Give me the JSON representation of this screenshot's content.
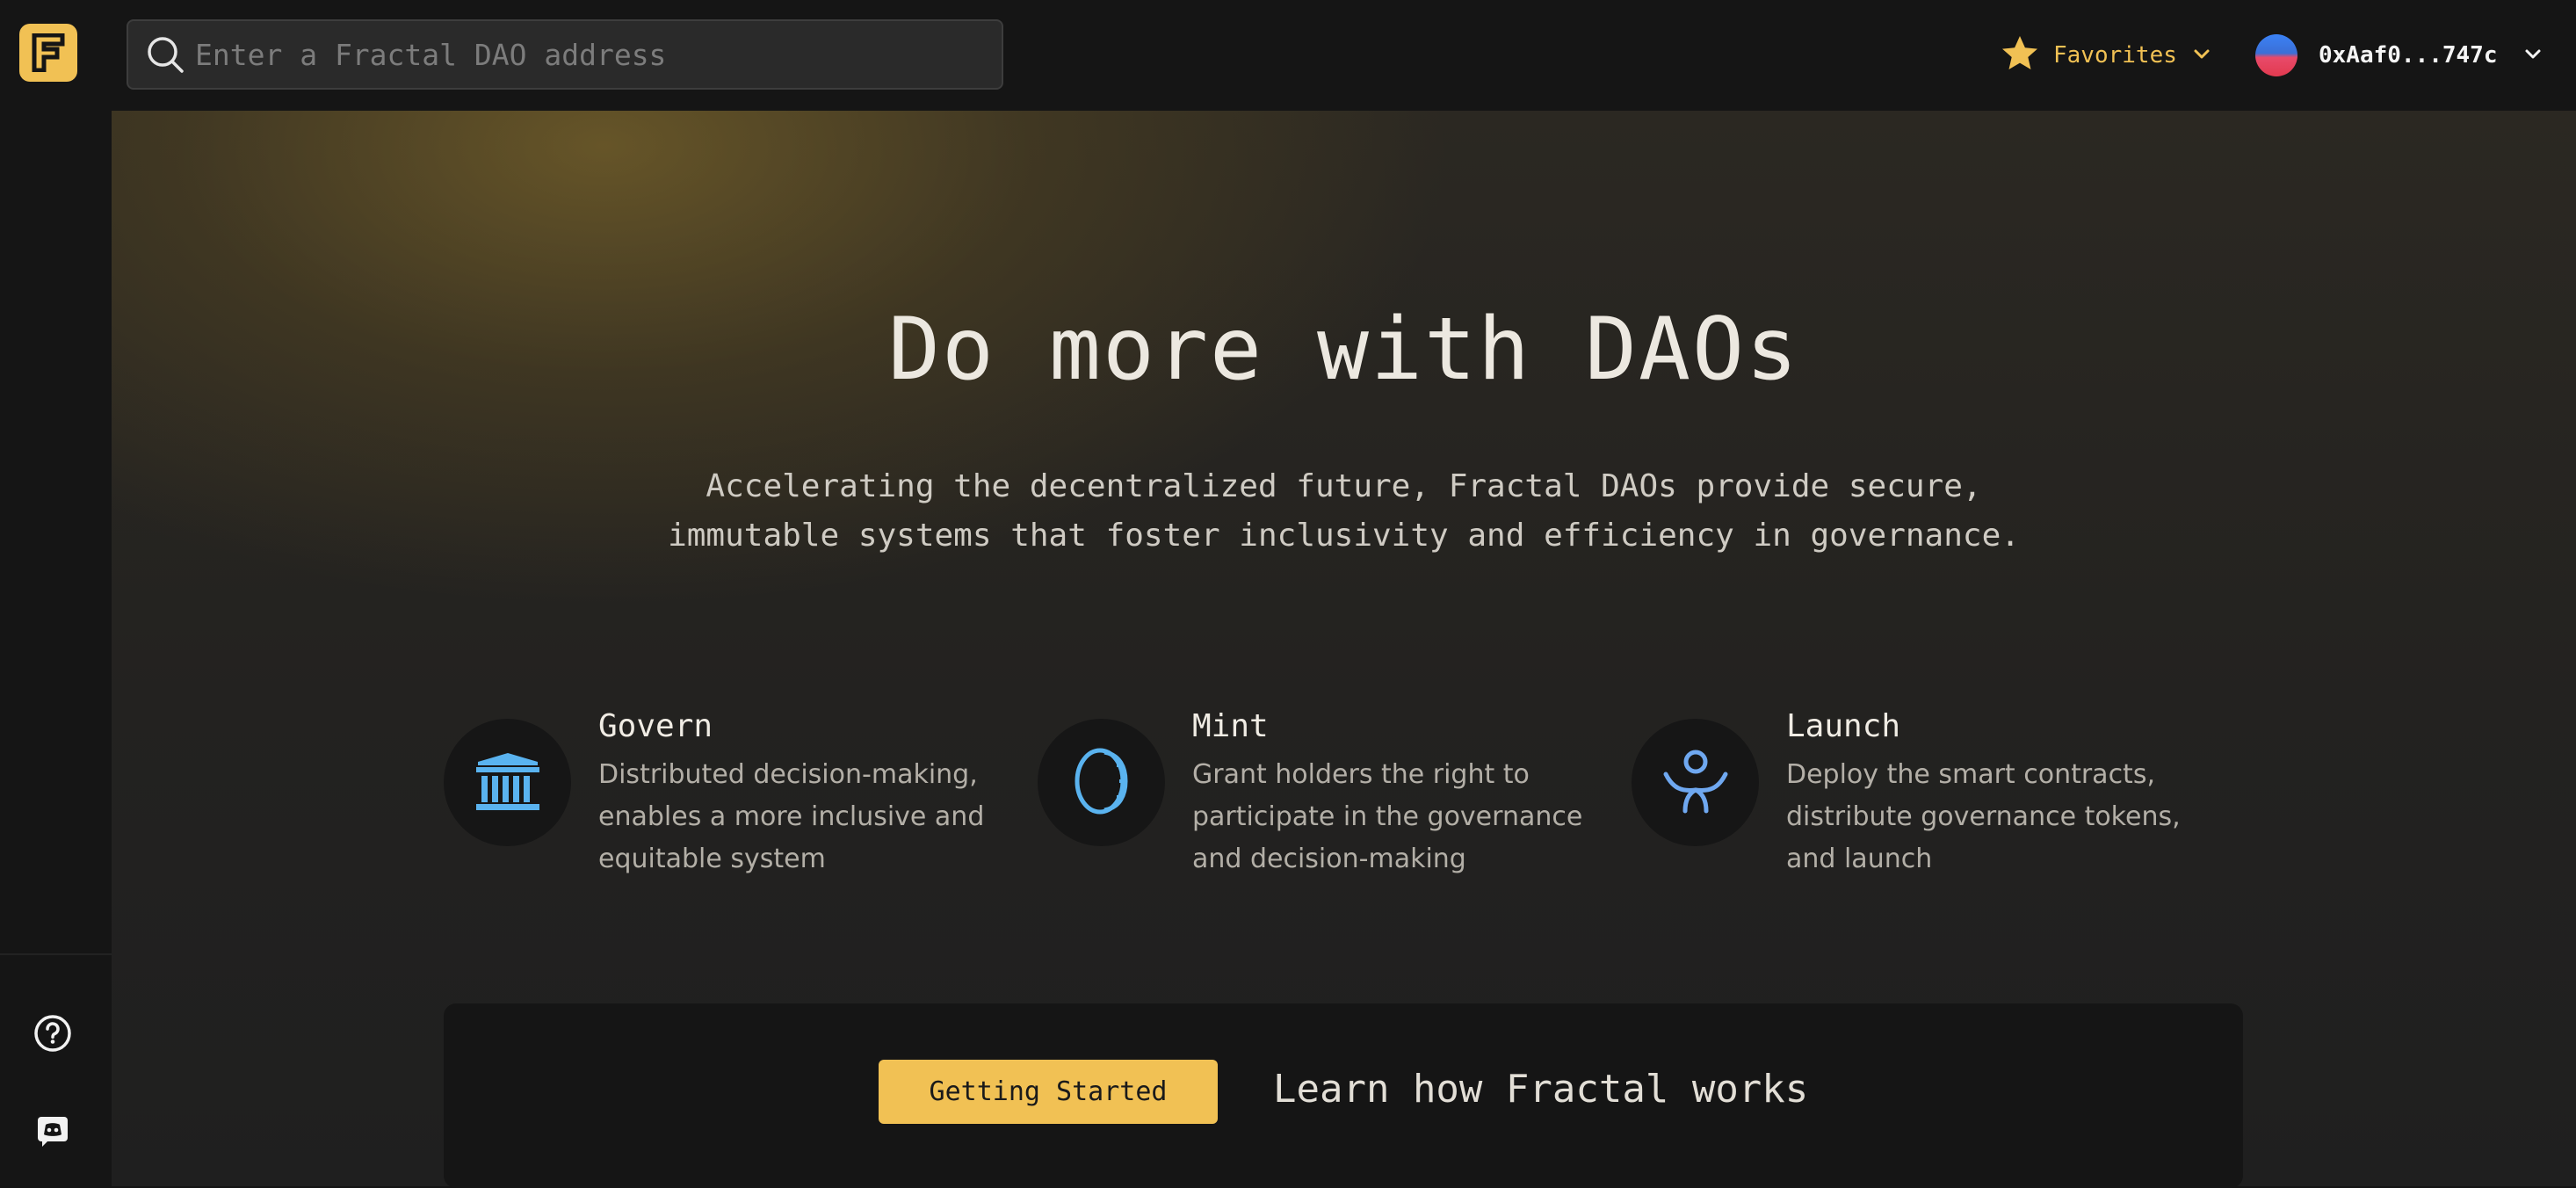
{
  "search": {
    "placeholder": "Enter a Fractal DAO address"
  },
  "header": {
    "favorites_label": "Favorites",
    "account_address": "0xAaf0...747c"
  },
  "hero": {
    "title": "Do more with DAOs",
    "subtitle_line1": "Accelerating the decentralized future, Fractal DAOs provide secure,",
    "subtitle_line2": "immutable systems that foster inclusivity and efficiency in governance."
  },
  "features": [
    {
      "title": "Govern",
      "icon": "bank-columns-icon",
      "description": "Distributed decision-making, enables a more inclusive and equitable system"
    },
    {
      "title": "Mint",
      "icon": "coin-icon",
      "description": "Grant holders the right to participate in the governance and decision-making"
    },
    {
      "title": "Launch",
      "icon": "person-arms-up-icon",
      "description": "Deploy the smart contracts, distribute governance tokens, and launch"
    }
  ],
  "cta": {
    "button_label": "Getting Started",
    "text": "Learn how Fractal works"
  },
  "colors": {
    "accent": "#f1c154",
    "icon_blue": "#5ab3ef"
  }
}
